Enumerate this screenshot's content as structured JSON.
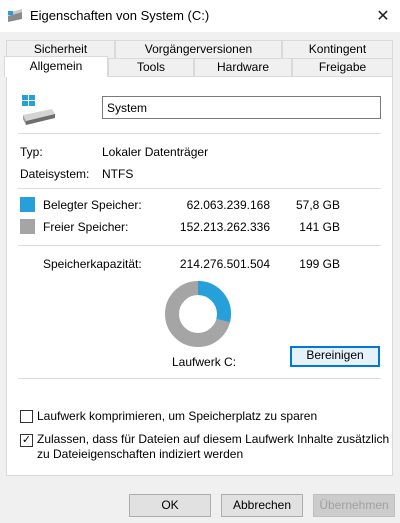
{
  "window": {
    "title": "Eigenschaften von System (C:)",
    "close_glyph": "✕"
  },
  "tabs": {
    "row1": [
      "Sicherheit",
      "Vorgängerversionen",
      "Kontingent"
    ],
    "row2": [
      "Allgemein",
      "Tools",
      "Hardware",
      "Freigabe"
    ],
    "active": "Allgemein"
  },
  "general": {
    "drive_name": "System",
    "type_label": "Typ:",
    "type_value": "Lokaler Datenträger",
    "fs_label": "Dateisystem:",
    "fs_value": "NTFS",
    "used": {
      "label": "Belegter Speicher:",
      "bytes": "62.063.239.168",
      "size": "57,8 GB",
      "color": "#26a0da"
    },
    "free": {
      "label": "Freier Speicher:",
      "bytes": "152.213.262.336",
      "size": "141 GB",
      "color": "#a5a5a5"
    },
    "capacity": {
      "label": "Speicherkapazität:",
      "bytes": "214.276.501.504",
      "size": "199 GB"
    },
    "used_fraction": 0.29,
    "drive_label": "Laufwerk C:",
    "cleanup_button": "Bereinigen",
    "compress_checkbox": {
      "label": "Laufwerk komprimieren, um Speicherplatz zu sparen",
      "checked": false
    },
    "index_checkbox": {
      "label_line1": "Zulassen, dass für Dateien auf diesem Laufwerk Inhalte zusätzlich",
      "label_line2": "zu Dateieigenschaften indiziert werden",
      "checked": true,
      "check_glyph": "✓"
    }
  },
  "footer": {
    "ok": "OK",
    "cancel": "Abbrechen",
    "apply": "Übernehmen"
  },
  "icons": {
    "window": "drive-icon",
    "close": "close-icon",
    "drive": "windows-drive-icon"
  }
}
